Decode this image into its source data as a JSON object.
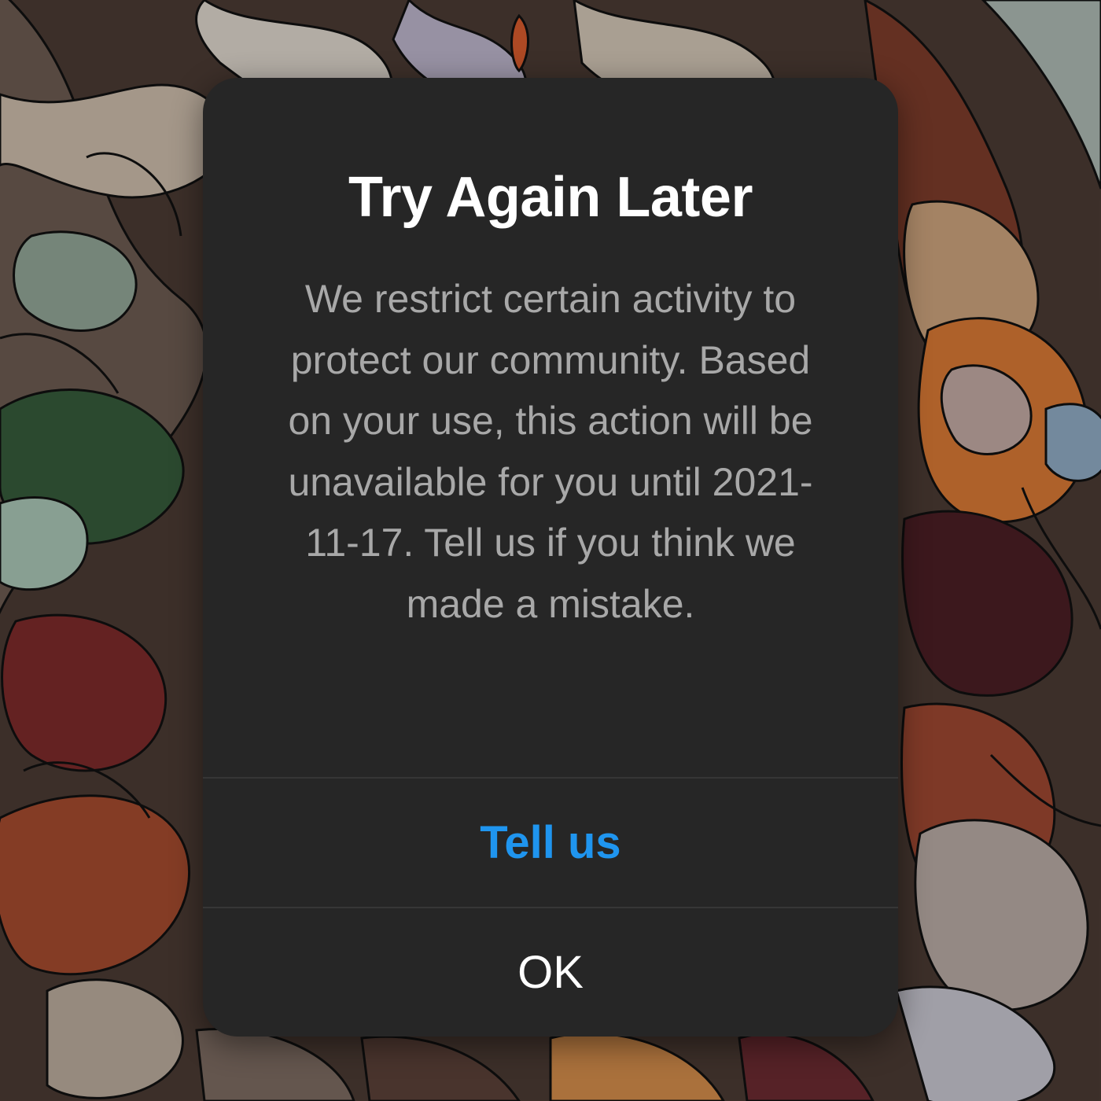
{
  "dialog": {
    "title": "Try Again Later",
    "message": "We restrict certain activity to protect our community. Based on your use, this action will be unavailable for you until 2021-11-17. Tell us if you think we made a mistake.",
    "primary_action": "Tell us",
    "secondary_action": "OK"
  },
  "colors": {
    "dialog_background": "#262626",
    "title_text": "#ffffff",
    "message_text": "#a8a8a8",
    "link_accent": "#1f95ef",
    "divider": "#363636"
  }
}
